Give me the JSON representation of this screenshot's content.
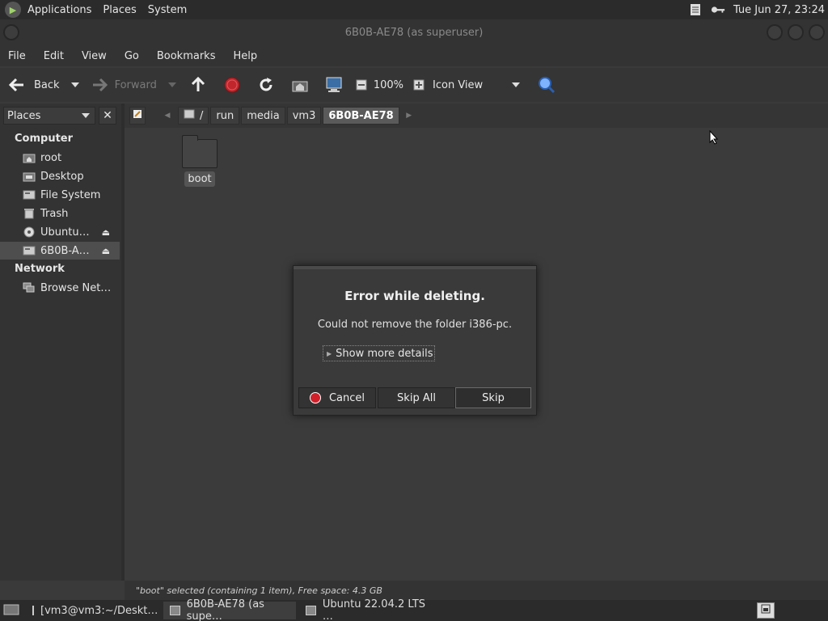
{
  "top_panel": {
    "menus": [
      "Applications",
      "Places",
      "System"
    ],
    "clock": "Tue Jun 27, 23:24"
  },
  "window": {
    "title": "6B0B-AE78 (as superuser)"
  },
  "menubar": [
    "File",
    "Edit",
    "View",
    "Go",
    "Bookmarks",
    "Help"
  ],
  "toolbar": {
    "back_label": "Back",
    "forward_label": "Forward",
    "zoom": "100%",
    "view_mode": "Icon View"
  },
  "sidebar": {
    "combo_label": "Places",
    "computer_header": "Computer",
    "items": [
      {
        "label": "root",
        "icon": "home-folder-icon"
      },
      {
        "label": "Desktop",
        "icon": "desktop-folder-icon"
      },
      {
        "label": "File System",
        "icon": "drive-icon"
      },
      {
        "label": "Trash",
        "icon": "trash-icon"
      },
      {
        "label": "Ubuntu…",
        "icon": "disc-icon"
      },
      {
        "label": "6B0B-A…",
        "icon": "usb-drive-icon"
      }
    ],
    "network_header": "Network",
    "network_items": [
      {
        "label": "Browse Net…",
        "icon": "network-icon"
      }
    ]
  },
  "location": {
    "crumbs": [
      "/",
      "run",
      "media",
      "vm3",
      "6B0B-AE78"
    ]
  },
  "content": {
    "folders": [
      {
        "name": "boot"
      }
    ]
  },
  "statusbar": {
    "text": "\"boot\" selected (containing 1 item), Free space: 4.3 GB"
  },
  "taskbar": {
    "tasks": [
      "[vm3@vm3:~/Deskt…",
      "6B0B-AE78 (as supe…",
      "Ubuntu 22.04.2 LTS …"
    ]
  },
  "dialog": {
    "title": "Error while deleting.",
    "message": "Could not remove the folder i386-pc.",
    "details_label": "Show more details",
    "cancel_label": "Cancel",
    "skip_all_label": "Skip All",
    "skip_label": "Skip"
  },
  "colors": {
    "stop_red": "#d0202a",
    "selected_bg": "#4e4e4e",
    "search_blue": "#3a7bd5"
  }
}
